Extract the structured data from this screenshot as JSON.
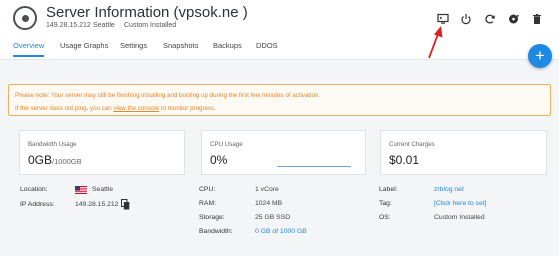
{
  "header": {
    "title": "Server Information (vpsok.ne )",
    "ip": "149.28.15.212",
    "location": "Seattle",
    "os": "Custom Installed"
  },
  "toolbar": {
    "icons": [
      "console-icon",
      "power-icon",
      "restart-icon",
      "reinstall-icon",
      "trash-icon"
    ]
  },
  "tabs": [
    {
      "label": "Overview",
      "active": true
    },
    {
      "label": "Usage Graphs"
    },
    {
      "label": "Settings"
    },
    {
      "label": "Snapshots"
    },
    {
      "label": "Backups"
    },
    {
      "label": "DDOS"
    }
  ],
  "fab": {
    "label": "+"
  },
  "notice": {
    "line1": "Please note: Your server may still be finishing installing and booting up during the first few minutes of activation.",
    "line2_pre": "If the server does not ping, you can ",
    "line2_link": "view the console",
    "line2_post": " to monitor progress."
  },
  "cards": {
    "bandwidth": {
      "label": "Bandwidth Usage",
      "value": "0GB",
      "sub": "/1000GB"
    },
    "cpu": {
      "label": "CPU Usage",
      "value": "0%"
    },
    "charges": {
      "label": "Current Charges",
      "value": "$0.01"
    }
  },
  "details": {
    "location_label": "Location:",
    "location_value": "Seattle",
    "ip_label": "IP Address:",
    "ip_value": "149.28.15.212",
    "cpu_label": "CPU:",
    "cpu_value": "1 vCore",
    "ram_label": "RAM:",
    "ram_value": "1024 MB",
    "storage_label": "Storage:",
    "storage_value": "25 GB SSD",
    "bandwidth_label": "Bandwidth:",
    "bandwidth_value": "0 GB of 1000 GB",
    "label_label": "Label:",
    "label_value": "zrblog.net",
    "tag_label": "Tag:",
    "tag_value": "[Click here to set]",
    "os_label": "OS:",
    "os_value": "Custom Installed"
  },
  "colors": {
    "accent": "#1e88e5",
    "notice_text": "#e8862a",
    "notice_border": "#f3ad5f",
    "annotation_arrow": "#e02020"
  }
}
